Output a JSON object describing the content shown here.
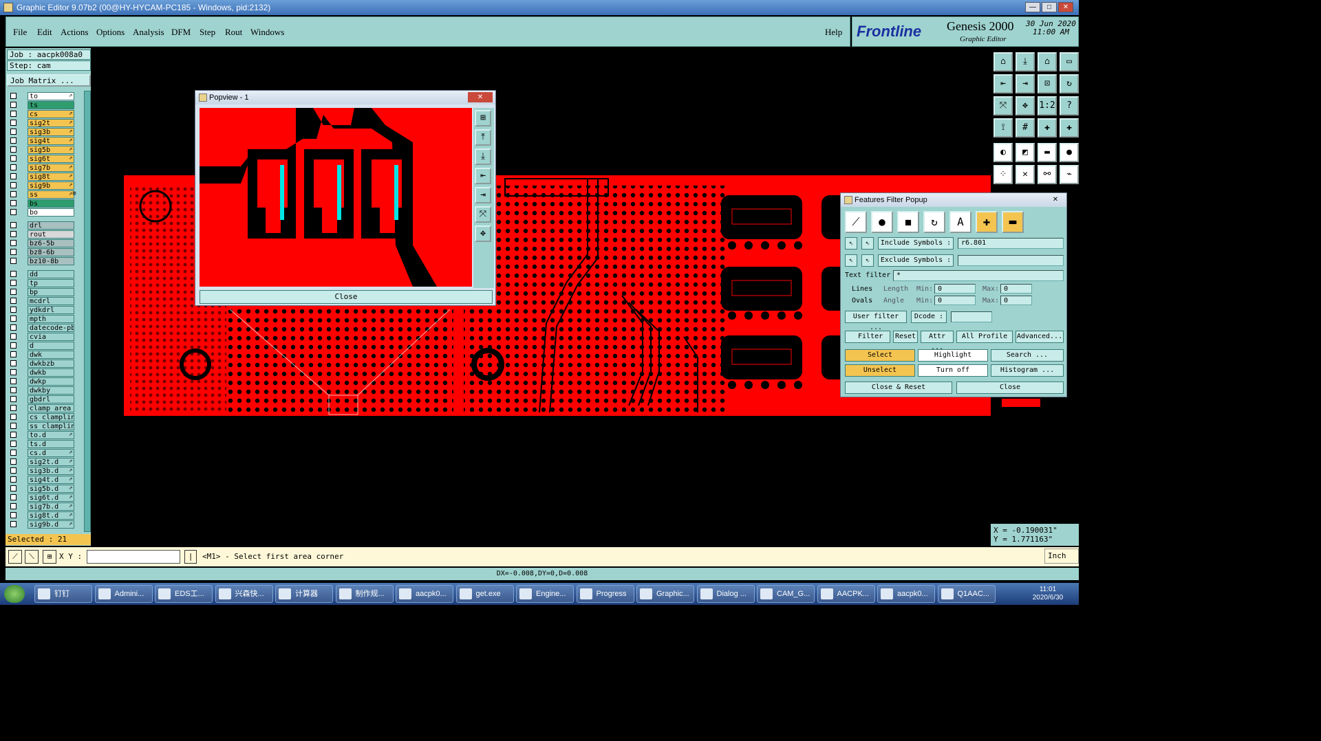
{
  "window": {
    "title": "Graphic Editor 9.07b2 (00@HY-HYCAM-PC185 - Windows, pid:2132)"
  },
  "menu": {
    "items": [
      "File",
      "Edit",
      "Actions",
      "Options",
      "Analysis",
      "DFM",
      "Step",
      "Rout",
      "Windows"
    ],
    "help": "Help"
  },
  "brand": {
    "logo": "Frontline",
    "product": "Genesis 2000",
    "subtitle": "Graphic Editor",
    "date": "30 Jun 2020",
    "time": "11:00 AM"
  },
  "job": {
    "job": "Job : aacpk008a0",
    "step": "Step: cam",
    "matrix_button": "Job Matrix ..."
  },
  "layers": [
    {
      "name": "to",
      "color": "#ffffff",
      "mark": "⇗"
    },
    {
      "name": "ts",
      "color": "#2f9d6e",
      "mark": ""
    },
    {
      "name": "cs",
      "color": "#f4c451",
      "mark": "⇗"
    },
    {
      "name": "sig2t",
      "color": "#f4c451",
      "mark": "⇗"
    },
    {
      "name": "sig3b",
      "color": "#f4c451",
      "mark": "⇗"
    },
    {
      "name": "sig4t",
      "color": "#f4c451",
      "mark": "⇗"
    },
    {
      "name": "sig5b",
      "color": "#f4c451",
      "mark": "⇗"
    },
    {
      "name": "sig6t",
      "color": "#f4c451",
      "mark": "⇗"
    },
    {
      "name": "sig7b",
      "color": "#f4c451",
      "mark": "⇗"
    },
    {
      "name": "sig8t",
      "color": "#f4c451",
      "mark": "⇗"
    },
    {
      "name": "sig9b",
      "color": "#f4c451",
      "mark": "⇗"
    },
    {
      "name": "ss",
      "color": "#f4c451",
      "mark": "⇗≡"
    },
    {
      "name": "bs",
      "color": "#2f9d6e",
      "mark": ""
    },
    {
      "name": "bo",
      "color": "#ffffff",
      "mark": ""
    },
    {
      "name": "drl",
      "color": "#a8c0c0",
      "mark": ""
    },
    {
      "name": "rout",
      "color": "#d8d8d8",
      "mark": ""
    },
    {
      "name": "bz6-5b",
      "color": "#a8c0c0",
      "mark": ""
    },
    {
      "name": "bz8-6b",
      "color": "#a8c0c0",
      "mark": ""
    },
    {
      "name": "bz10-8b",
      "color": "#a8c0c0",
      "mark": ""
    },
    {
      "name": "dd",
      "color": "#9fd3cf",
      "mark": ""
    },
    {
      "name": "tp",
      "color": "#9fd3cf",
      "mark": ""
    },
    {
      "name": "bp",
      "color": "#9fd3cf",
      "mark": ""
    },
    {
      "name": "mcdrl",
      "color": "#9fd3cf",
      "mark": ""
    },
    {
      "name": "ydkdrl",
      "color": "#9fd3cf",
      "mark": ""
    },
    {
      "name": "mpth",
      "color": "#9fd3cf",
      "mark": ""
    },
    {
      "name": "datecode-pb",
      "color": "#9fd3cf",
      "mark": ""
    },
    {
      "name": "cvia",
      "color": "#9fd3cf",
      "mark": ""
    },
    {
      "name": "d",
      "color": "#9fd3cf",
      "mark": ""
    },
    {
      "name": "dwk",
      "color": "#9fd3cf",
      "mark": ""
    },
    {
      "name": "dwkbzb",
      "color": "#9fd3cf",
      "mark": ""
    },
    {
      "name": "dwkb",
      "color": "#9fd3cf",
      "mark": ""
    },
    {
      "name": "dwkp",
      "color": "#9fd3cf",
      "mark": ""
    },
    {
      "name": "dwkby",
      "color": "#9fd3cf",
      "mark": ""
    },
    {
      "name": "gbdrl",
      "color": "#9fd3cf",
      "mark": ""
    },
    {
      "name": "clamp_area",
      "color": "#9fd3cf",
      "mark": ""
    },
    {
      "name": "cs_clampline",
      "color": "#9fd3cf",
      "mark": ""
    },
    {
      "name": "ss_clampline",
      "color": "#9fd3cf",
      "mark": ""
    },
    {
      "name": "to.d",
      "color": "#9fd3cf",
      "mark": "⇗"
    },
    {
      "name": "ts.d",
      "color": "#9fd3cf",
      "mark": ""
    },
    {
      "name": "cs.d",
      "color": "#9fd3cf",
      "mark": "⇗"
    },
    {
      "name": "sig2t.d",
      "color": "#9fd3cf",
      "mark": "⇗"
    },
    {
      "name": "sig3b.d",
      "color": "#9fd3cf",
      "mark": "⇗"
    },
    {
      "name": "sig4t.d",
      "color": "#9fd3cf",
      "mark": "⇗"
    },
    {
      "name": "sig5b.d",
      "color": "#9fd3cf",
      "mark": "⇗"
    },
    {
      "name": "sig6t.d",
      "color": "#9fd3cf",
      "mark": "⇗"
    },
    {
      "name": "sig7b.d",
      "color": "#9fd3cf",
      "mark": "⇗"
    },
    {
      "name": "sig8t.d",
      "color": "#9fd3cf",
      "mark": "⇗"
    },
    {
      "name": "sig9b.d",
      "color": "#9fd3cf",
      "mark": "⇗"
    }
  ],
  "selected": "Selected : 21",
  "coords": {
    "x": "X = -0.190031\"",
    "y": "Y = 1.771163\""
  },
  "cmd": {
    "xy_label": "X Y :",
    "xy_value": "",
    "prompt": "<M1> - Select first area corner",
    "units": "Inch"
  },
  "status": "DX=-0.008,DY=0,D=0.008",
  "popview": {
    "title": "Popview - 1",
    "close": "Close"
  },
  "filter": {
    "title": "Features Filter Popup",
    "include_label": "Include Symbols :",
    "include_value": "r6.801",
    "exclude_label": "Exclude Symbols :",
    "exclude_value": "",
    "text_filter_label": "Text filter",
    "text_filter_value": "*",
    "lines": "Lines",
    "ovals": "Ovals",
    "length": "Length",
    "angle": "Angle",
    "min": "Min:",
    "max": "Max:",
    "min_len": "0",
    "max_len": "0",
    "min_ang": "0",
    "max_ang": "0",
    "user_filter": "User filter ...",
    "dcode": "Dcode :",
    "dcode_value": "",
    "filter_check": "Filter",
    "reset": "Reset",
    "attr": "Attr ...",
    "profile": "All Profile",
    "advanced": "Advanced...",
    "select": "Select",
    "highlight": "Highlight",
    "search": "Search ...",
    "unselect": "Unselect",
    "turn_off": "Turn off",
    "histogram": "Histogram ...",
    "close_reset": "Close & Reset",
    "close": "Close"
  },
  "taskbar": {
    "items": [
      "钉钉",
      "Admini...",
      "EDS工...",
      "兴森快...",
      "计算器",
      "制作规...",
      "aacpk0...",
      "get.exe",
      "Engine...",
      "Progress",
      "Graphic...",
      "Dialog ...",
      "CAM_G...",
      "AACPK...",
      "aacpk0...",
      "Q1AAC..."
    ],
    "time": "11:01",
    "date": "2020/6/30"
  },
  "colors": {
    "panel": "#9fd3cf",
    "pcb": "#ff0000",
    "highlight": "#00e5e5",
    "active": "#f4c451"
  }
}
